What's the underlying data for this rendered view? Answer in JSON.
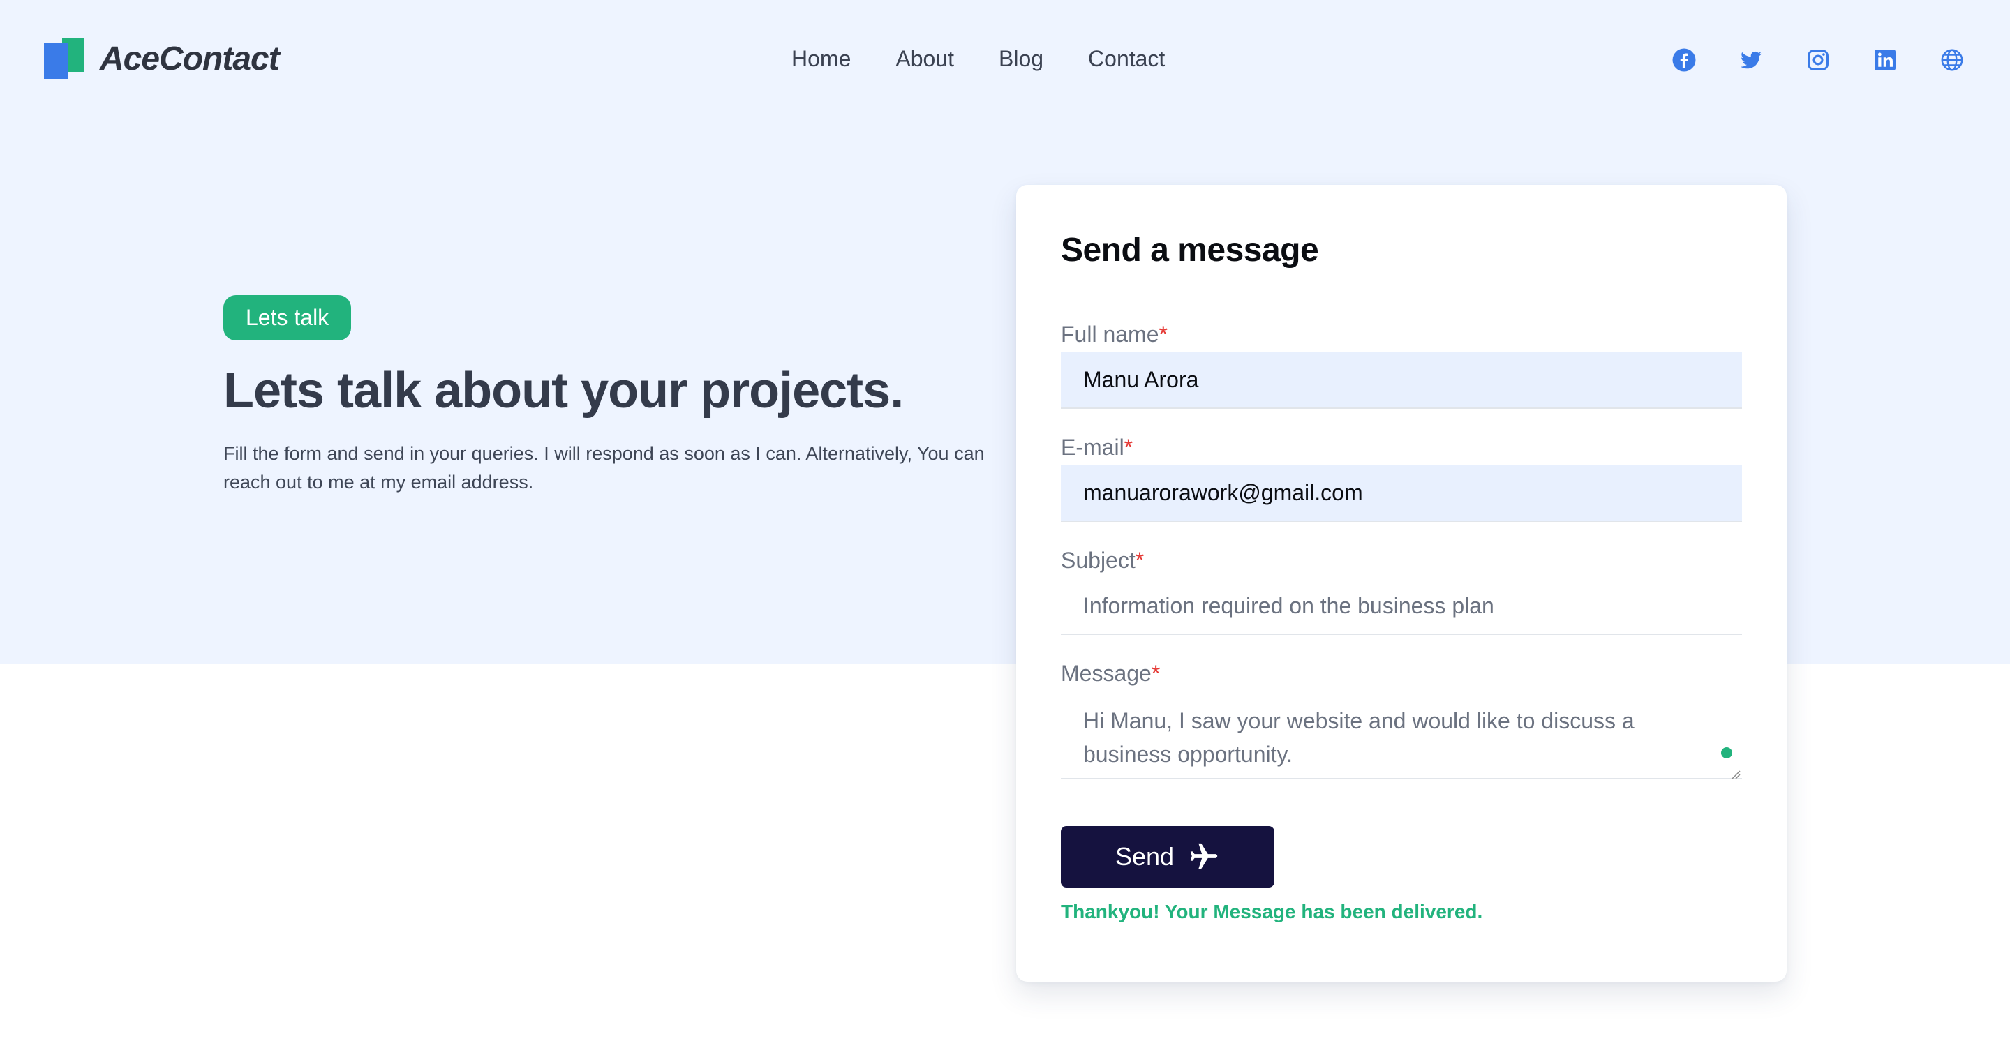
{
  "brand": {
    "name": "AceContact"
  },
  "nav": {
    "items": [
      {
        "label": "Home"
      },
      {
        "label": "About"
      },
      {
        "label": "Blog"
      },
      {
        "label": "Contact"
      }
    ]
  },
  "socials": [
    {
      "icon": "facebook-icon"
    },
    {
      "icon": "twitter-icon"
    },
    {
      "icon": "instagram-icon"
    },
    {
      "icon": "linkedin-icon"
    },
    {
      "icon": "globe-icon"
    }
  ],
  "hero": {
    "tag": "Lets talk",
    "title": "Lets talk about your projects.",
    "description": "Fill the form and send in your queries. I will respond as soon as I can. Alternatively, You can reach out to me at my email address."
  },
  "form": {
    "title": "Send a message",
    "required_mark": "*",
    "full_name": {
      "label": "Full name",
      "value": "Manu Arora"
    },
    "email": {
      "label": "E-mail",
      "value": "manuarorawork@gmail.com"
    },
    "subject": {
      "label": "Subject",
      "value": "Information required on the business plan"
    },
    "message": {
      "label": "Message",
      "value": "Hi Manu, I saw your website and would like to discuss a business opportunity."
    },
    "send_label": "Send",
    "success_text": "Thankyou! Your Message has been delivered."
  },
  "colors": {
    "accent_green": "#22b37d",
    "brand_blue": "#3a7be8",
    "button_dark": "#15123f",
    "hero_bg": "#eef4ff",
    "required_red": "#e53935"
  }
}
